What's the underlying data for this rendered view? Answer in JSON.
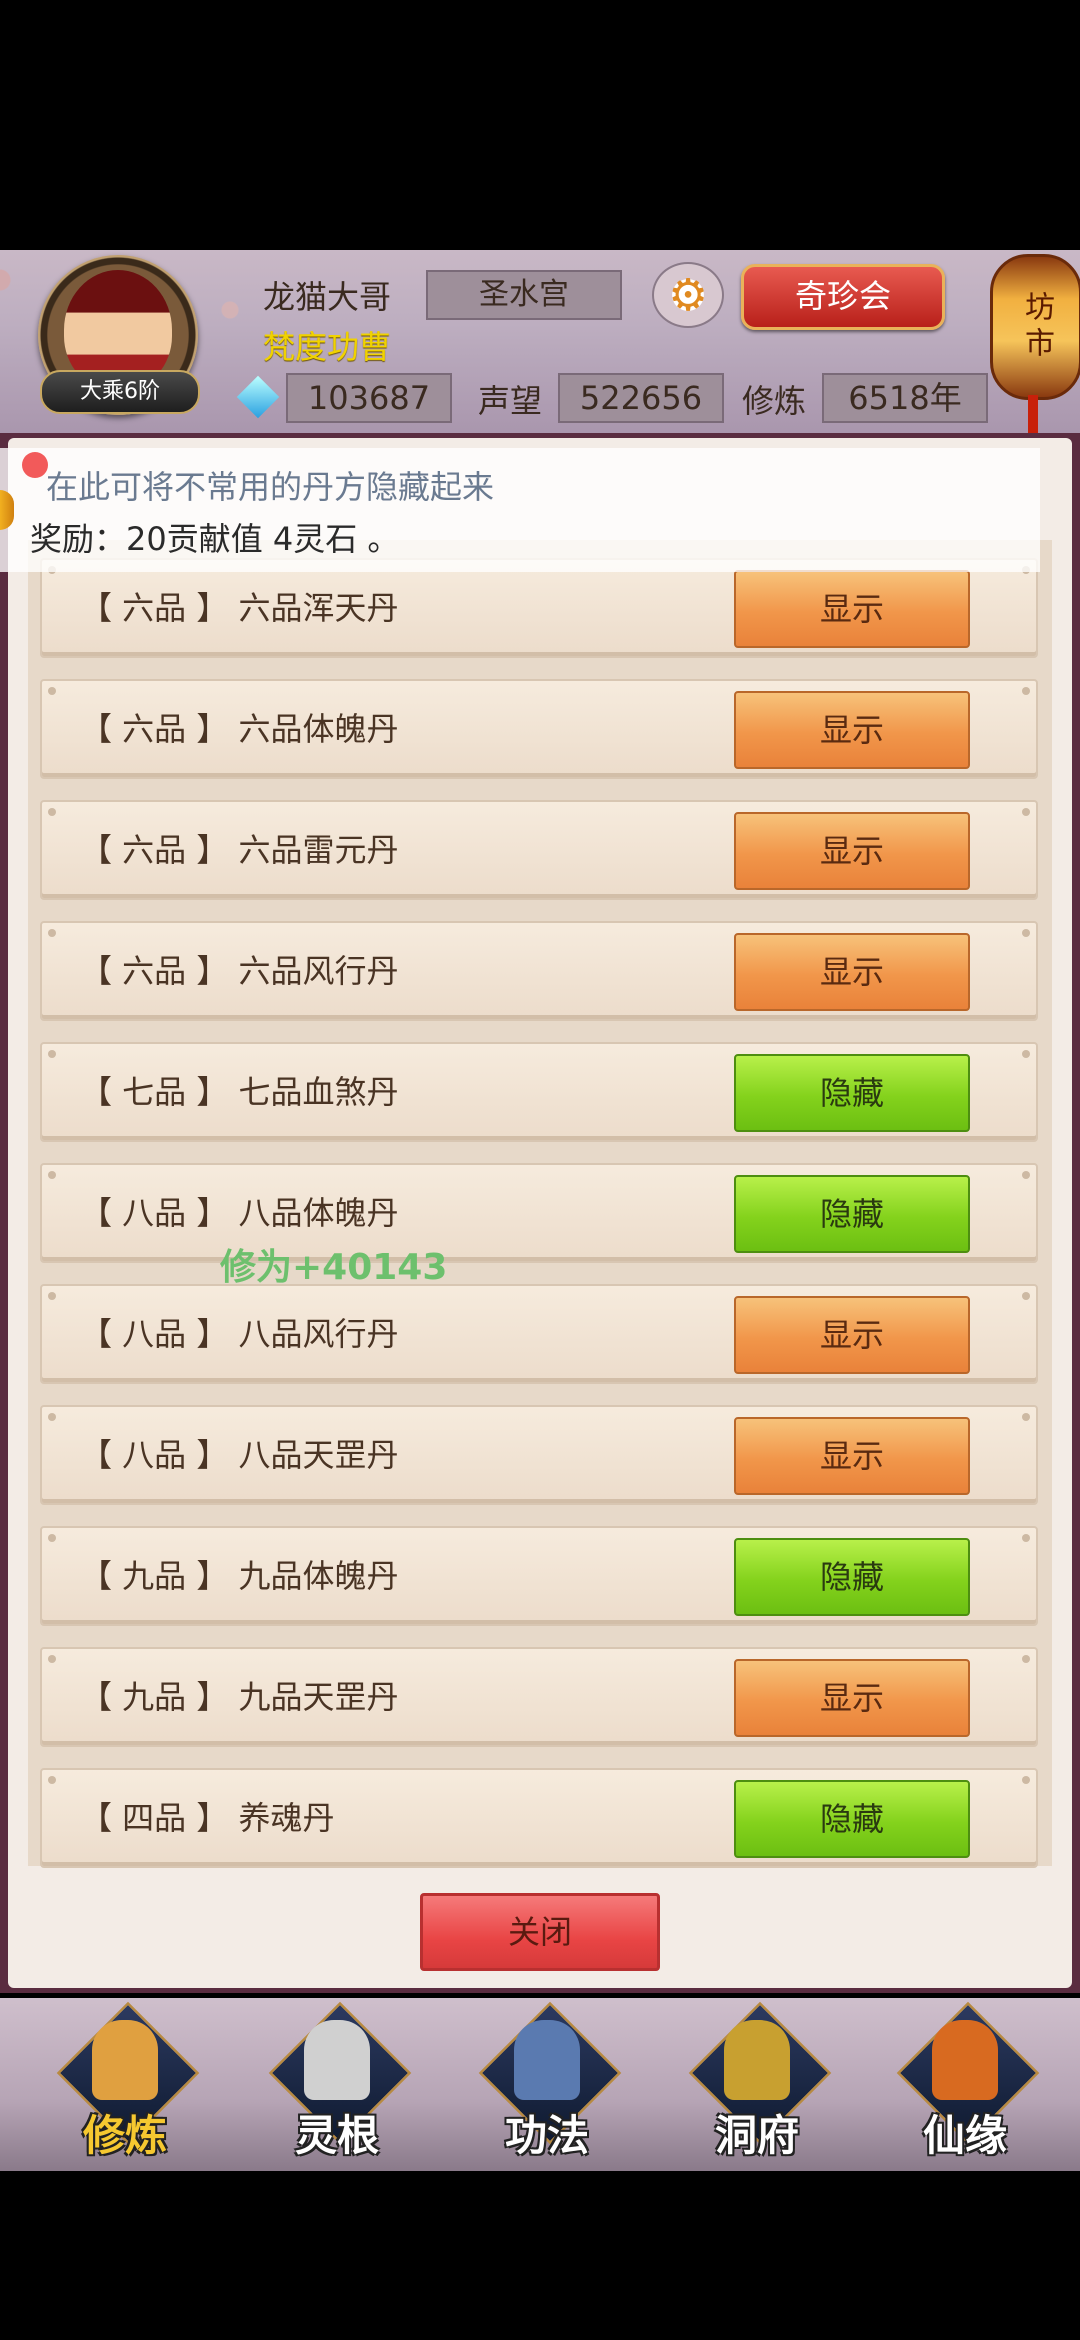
{
  "header": {
    "player_name": "龙猫大哥",
    "player_title": "梵度功曹",
    "rank_badge": "大乘6阶",
    "sect": "圣水宫",
    "treasure_button": "奇珍会",
    "market_lantern": "坊市",
    "stats": {
      "lingshi_value": "103687",
      "fame_label": "声望",
      "fame_value": "522656",
      "cultivation_label": "修炼",
      "cultivation_value": "6518年"
    }
  },
  "tooltip": {
    "line1": "在此可将不常用的丹方隐藏起来",
    "line2": "奖励：20贡献值 4灵石 。"
  },
  "floating_text": "修为+40143",
  "pill_list": [
    {
      "label": "【 六品 】 六品浑天丹",
      "button": "显示",
      "state": "show"
    },
    {
      "label": "【 六品 】 六品体魄丹",
      "button": "显示",
      "state": "show"
    },
    {
      "label": "【 六品 】 六品雷元丹",
      "button": "显示",
      "state": "show"
    },
    {
      "label": "【 六品 】 六品风行丹",
      "button": "显示",
      "state": "show"
    },
    {
      "label": "【 七品 】 七品血煞丹",
      "button": "隐藏",
      "state": "hide"
    },
    {
      "label": "【 八品 】 八品体魄丹",
      "button": "隐藏",
      "state": "hide"
    },
    {
      "label": "【 八品 】 八品风行丹",
      "button": "显示",
      "state": "show"
    },
    {
      "label": "【 八品 】 八品天罡丹",
      "button": "显示",
      "state": "show"
    },
    {
      "label": "【 九品 】 九品体魄丹",
      "button": "隐藏",
      "state": "hide"
    },
    {
      "label": "【 九品 】 九品天罡丹",
      "button": "显示",
      "state": "show"
    },
    {
      "label": "【 四品 】 养魂丹",
      "button": "隐藏",
      "state": "hide"
    }
  ],
  "close_button": "关闭",
  "bottom_nav": [
    {
      "label": "修炼",
      "icon": "hooded-monk-icon",
      "active": true
    },
    {
      "label": "灵根",
      "icon": "yin-yang-sword-icon",
      "active": false
    },
    {
      "label": "功法",
      "icon": "scroll-book-icon",
      "active": false
    },
    {
      "label": "洞府",
      "icon": "pagoda-icon",
      "active": false
    },
    {
      "label": "仙缘",
      "icon": "gourd-icon",
      "active": false
    }
  ],
  "colors": {
    "show_button": "#f1964a",
    "hide_button": "#84d21c",
    "close_button": "#e94545",
    "title_yellow": "#f0d200",
    "panel_frame": "#5a2c40"
  }
}
